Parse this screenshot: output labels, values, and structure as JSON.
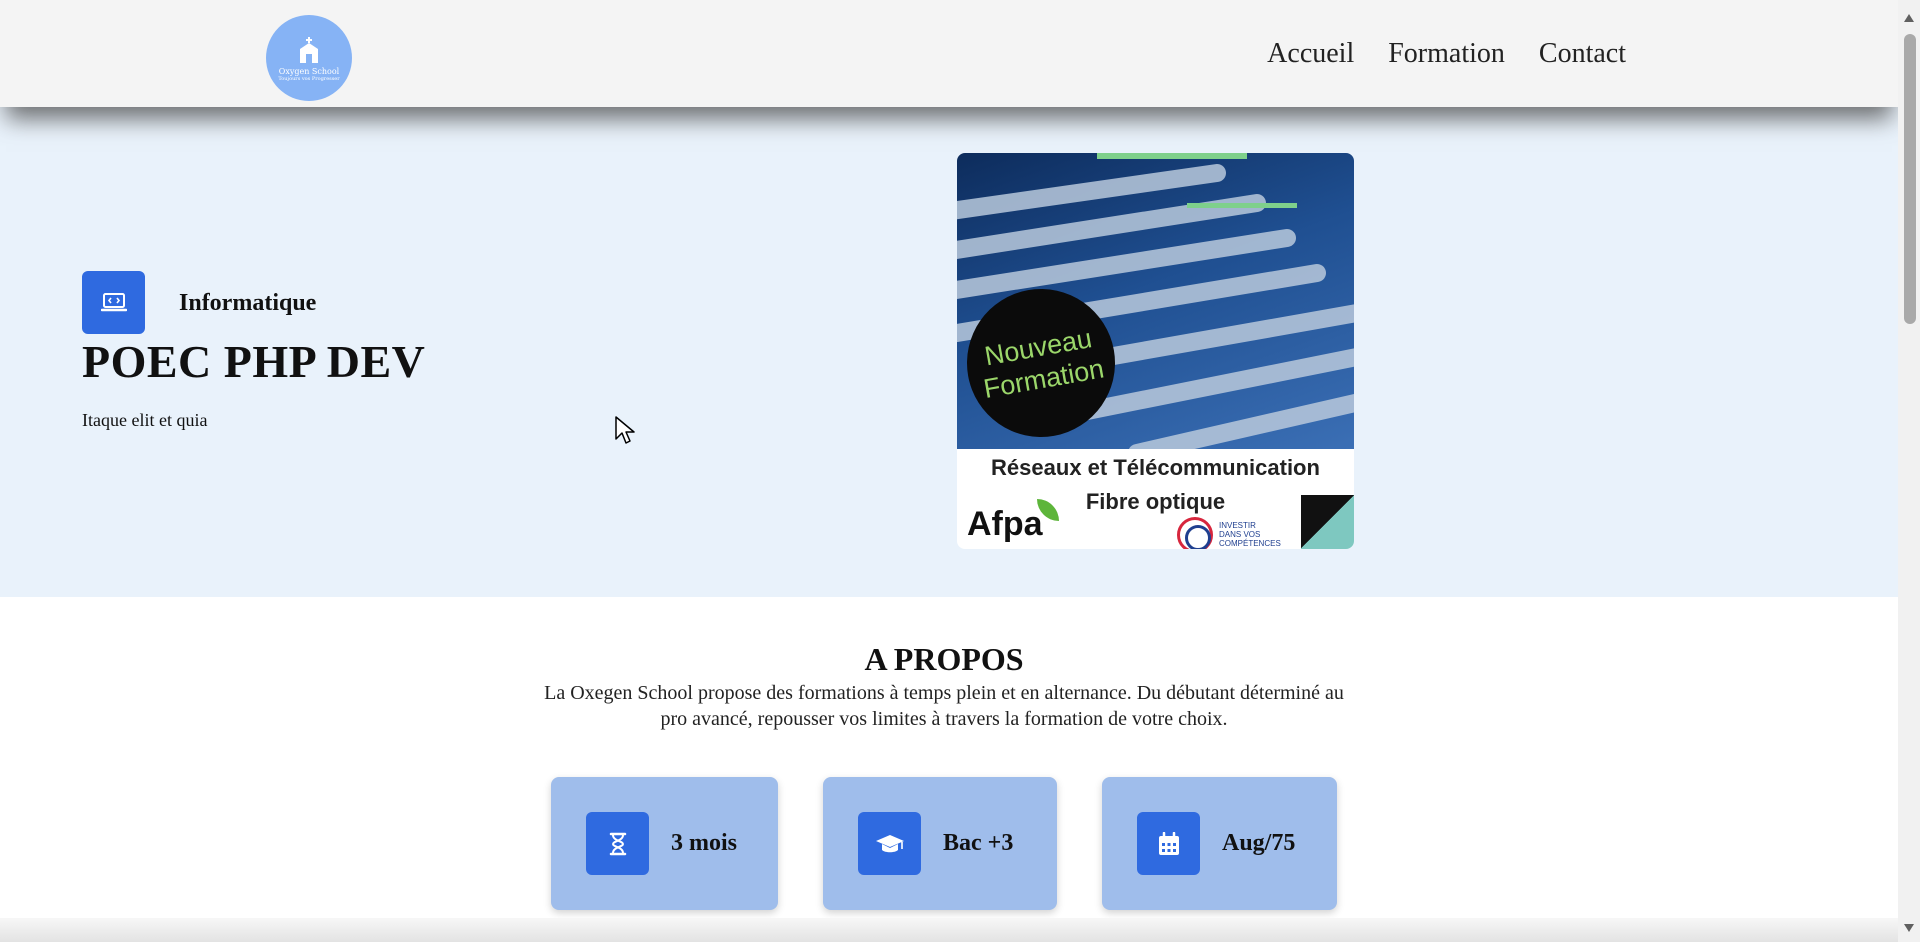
{
  "header": {
    "logo": {
      "name": "Oxygen School",
      "tagline": "Toujours vos Progresser"
    },
    "nav": [
      {
        "label": "Accueil"
      },
      {
        "label": "Formation"
      },
      {
        "label": "Contact"
      }
    ]
  },
  "hero": {
    "category": {
      "icon": "code-laptop-icon",
      "label": "Informatique"
    },
    "title": "POEC PHP DEV",
    "subtitle": "Itaque elit et quia",
    "promo": {
      "badge_lines": [
        "Nouveau",
        "Formation"
      ],
      "line1": "Réseaux et Télécommunication",
      "line2": "Fibre optique",
      "afpa": "Afpa",
      "invest_text": [
        "INVESTIR",
        "DANS VOS",
        "COMPÉTENCES"
      ]
    }
  },
  "about": {
    "title": "A PROPOS",
    "text": "La Oxegen School propose des formations à temps plein et en alternance. Du débutant déterminé au pro avancé, repousser vos limites à travers la formation de votre choix.",
    "cards": [
      {
        "icon": "hourglass-icon",
        "label": "3 mois"
      },
      {
        "icon": "graduation-cap-icon",
        "label": "Bac +3"
      },
      {
        "icon": "calendar-icon",
        "label": "Aug/75"
      }
    ]
  },
  "colors": {
    "header_bg": "#f4f4f4",
    "hero_bg": "#e9f2fb",
    "accent": "#2f6ae0",
    "card_bg": "#9fbdeb",
    "logo_bg": "#86b3f5"
  }
}
